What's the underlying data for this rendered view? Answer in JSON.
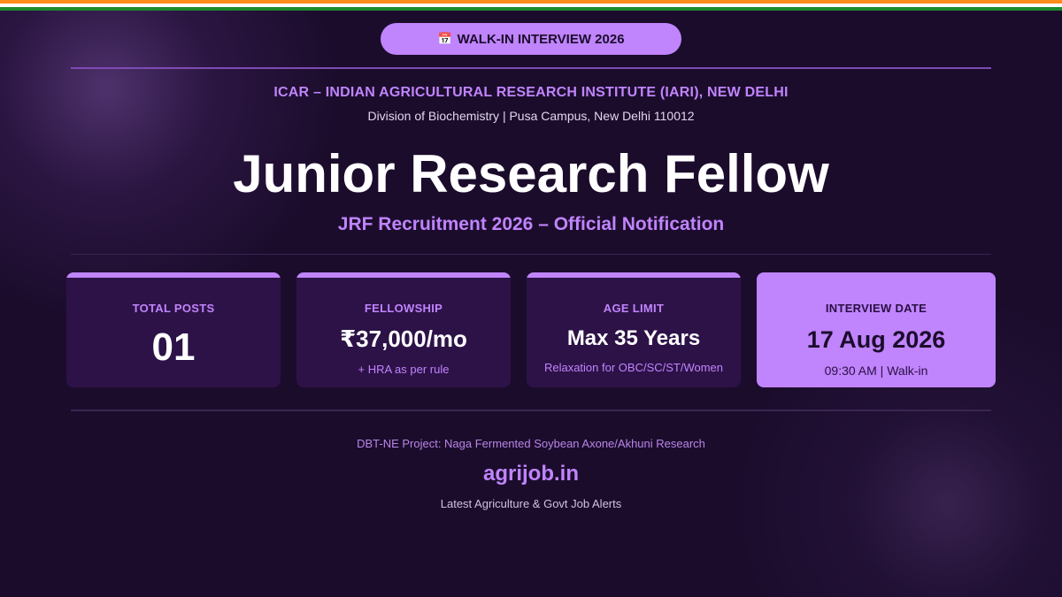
{
  "colors": {
    "background": "#1b0c2c",
    "accent": "#c084fc",
    "card_bg": "#2d1248",
    "saffron": "#ff8c1a",
    "white": "#ffffff",
    "green": "#1e8a2e"
  },
  "badge": {
    "icon": "calendar-icon",
    "glyph": "📅",
    "label": "WALK-IN INTERVIEW 2026"
  },
  "organization": {
    "name": "ICAR – INDIAN AGRICULTURAL RESEARCH INSTITUTE (IARI), NEW DELHI",
    "subtitle": "Division of Biochemistry | Pusa Campus, New Delhi 110012"
  },
  "headline": "Junior Research Fellow",
  "subheadline": "JRF Recruitment 2026 – Official Notification",
  "cards": [
    {
      "label": "TOTAL POSTS",
      "value": "01",
      "note": ""
    },
    {
      "label": "FELLOWSHIP",
      "currency": "₹",
      "value": "37,000/mo",
      "note": "+ HRA as per rule"
    },
    {
      "label": "AGE LIMIT",
      "value": "Max 35 Years",
      "note": "Relaxation for OBC/SC/ST/Women"
    },
    {
      "label": "INTERVIEW DATE",
      "value": "17 Aug 2026",
      "note": "09:30 AM | Walk-in"
    }
  ],
  "footer": {
    "project": "DBT-NE Project: Naga Fermented Soybean Axone/Akhuni Research",
    "site": "agrijob.in",
    "tagline": "Latest Agriculture & Govt Job Alerts"
  }
}
